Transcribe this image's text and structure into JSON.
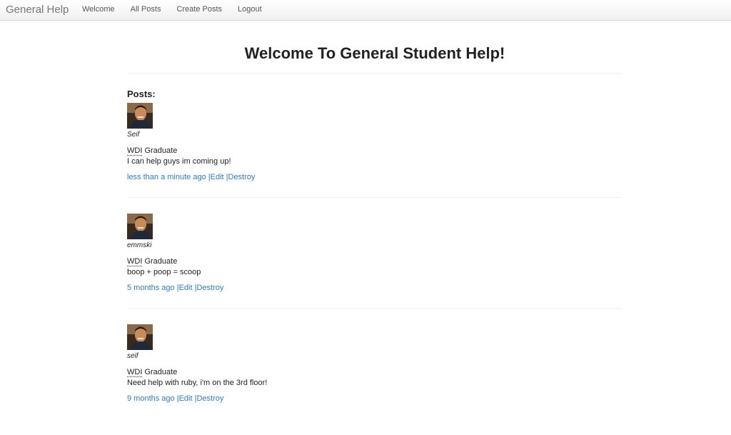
{
  "navbar": {
    "brand": "General Help",
    "links": [
      "Welcome",
      "All Posts",
      "Create Posts",
      "Logout"
    ]
  },
  "page": {
    "title": "Welcome To General Student Help!",
    "posts_heading": "Posts:"
  },
  "posts": [
    {
      "username": "Seif",
      "course": "WDI",
      "role_suffix": " Graduate",
      "content": "I can help guys im coming up!",
      "time_ago": "less than a minute ago",
      "sep1": " |",
      "edit": "Edit",
      "sep2": " |",
      "destroy": "Destroy"
    },
    {
      "username": "emmski",
      "course": "WDI",
      "role_suffix": " Graduate",
      "content": "boop + poop = scoop",
      "time_ago": "5 months ago",
      "sep1": " |",
      "edit": "Edit",
      "sep2": " |",
      "destroy": "Destroy"
    },
    {
      "username": "seif",
      "course": "WDI",
      "role_suffix": " Graduate",
      "content": "Need help with ruby, i'm on the 3rd floor!",
      "time_ago": "9 months ago",
      "sep1": " |",
      "edit": "Edit",
      "sep2": " |",
      "destroy": "Destroy"
    }
  ],
  "colors": {
    "link": "#337ab7",
    "text": "#222222",
    "brand": "#777777"
  }
}
